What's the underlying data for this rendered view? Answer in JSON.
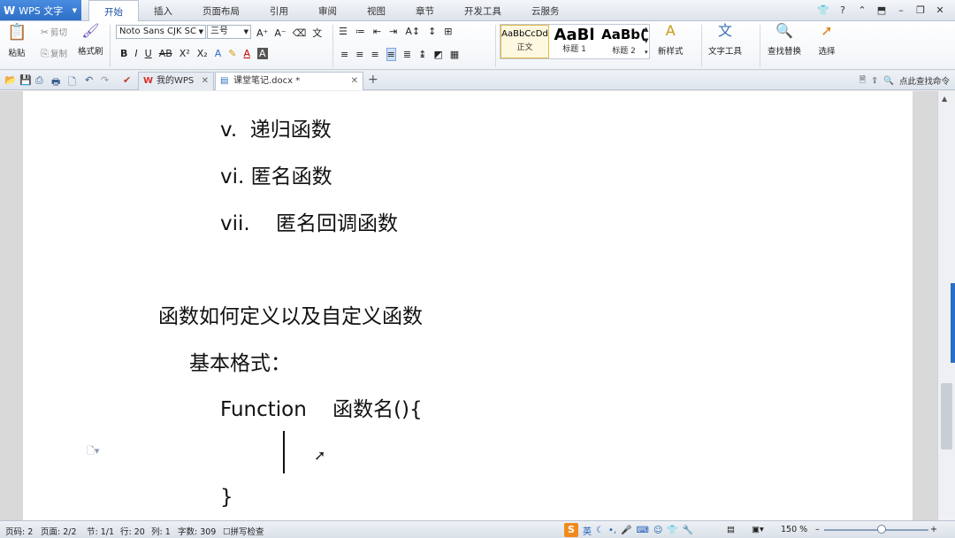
{
  "app": {
    "name": "WPS 文字"
  },
  "menu": {
    "tabs": [
      "开始",
      "插入",
      "页面布局",
      "引用",
      "审阅",
      "视图",
      "章节",
      "开发工具",
      "云服务"
    ],
    "active": "开始"
  },
  "ribbon": {
    "paste": "粘贴",
    "cut": "剪切",
    "copy": "复制",
    "format_painter": "格式刷",
    "font_name": "Noto Sans CJK SC",
    "font_size": "三号",
    "styles": [
      {
        "sample": "AaBbCcDd",
        "label": "正文"
      },
      {
        "sample": "AaBl",
        "label": "标题 1"
      },
      {
        "sample": "AaBb(",
        "label": "标题 2"
      }
    ],
    "new_style": "新样式",
    "text_tools": "文字工具",
    "find_replace": "查找替换",
    "select": "选择"
  },
  "tabs_bar": {
    "wps_tab": "我的WPS",
    "doc_tab": "课堂笔记.docx *",
    "search_cmd": "点此查找命令"
  },
  "document": {
    "lines": [
      "v.  递归函数",
      "vi. 匿名函数",
      "vii.    匿名回调函数",
      "函数如何定义以及自定义函数",
      "基本格式：",
      "Function    函数名(){",
      "}"
    ]
  },
  "status": {
    "page_code": "页码: 2",
    "page": "页面: 2/2",
    "section": "节: 1/1",
    "row": "行: 20",
    "col": "列: 1",
    "word_count": "字数: 309",
    "spell_check": "拼写检查",
    "ime_mode": "英",
    "zoom": "150 %"
  },
  "colors": {
    "accent": "#2d6fc6",
    "ime": "#f08a1c"
  }
}
